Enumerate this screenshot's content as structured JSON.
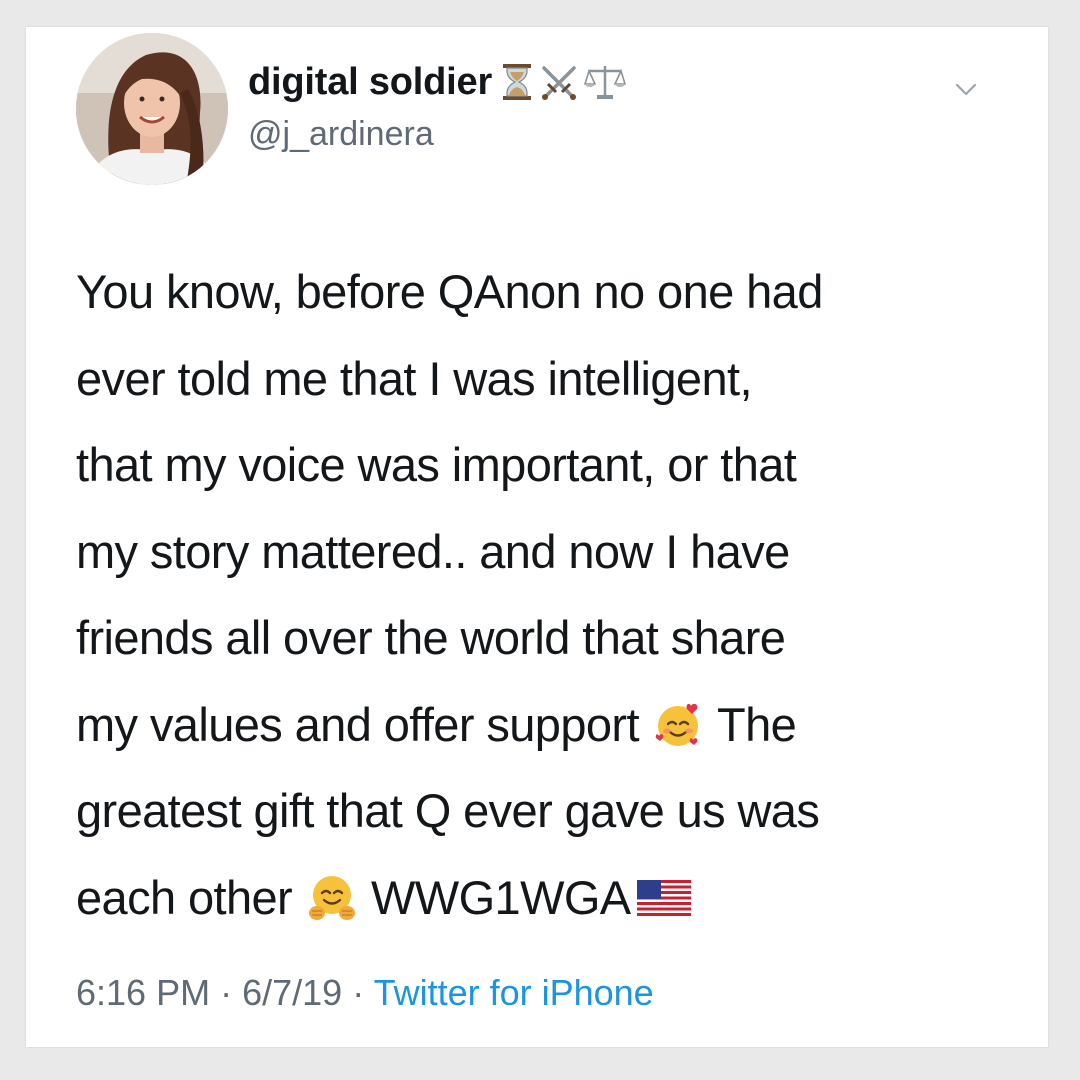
{
  "user": {
    "display_name": "digital soldier",
    "handle": "@j_ardinera",
    "name_emojis": [
      "hourglass-icon",
      "crossed-swords-icon",
      "scales-icon"
    ]
  },
  "tweet": {
    "lines": [
      {
        "text": "You know, before QAnon no one had"
      },
      {
        "text": "ever told me that I was intelligent,"
      },
      {
        "text": "that my voice was important, or that"
      },
      {
        "text": "my story mattered.. and now I have"
      },
      {
        "text": "friends all over the world that share"
      },
      {
        "text": "my values and offer support",
        "emoji": "smiling-face-with-hearts-icon",
        "after": "The"
      },
      {
        "text": "greatest gift that Q ever gave us was"
      },
      {
        "text": "each other",
        "emoji": "hugging-face-icon",
        "after": "WWG1WGA",
        "flag": "us-flag-icon"
      }
    ]
  },
  "meta": {
    "time": "6:16 PM",
    "sep1": "·",
    "date": "6/7/19",
    "sep2": "·",
    "source": "Twitter for iPhone"
  },
  "colors": {
    "text": "#14171a",
    "secondary": "#5f6a74",
    "link": "#1b95e0",
    "background": "#ffffff",
    "page": "#e9e9ea"
  }
}
